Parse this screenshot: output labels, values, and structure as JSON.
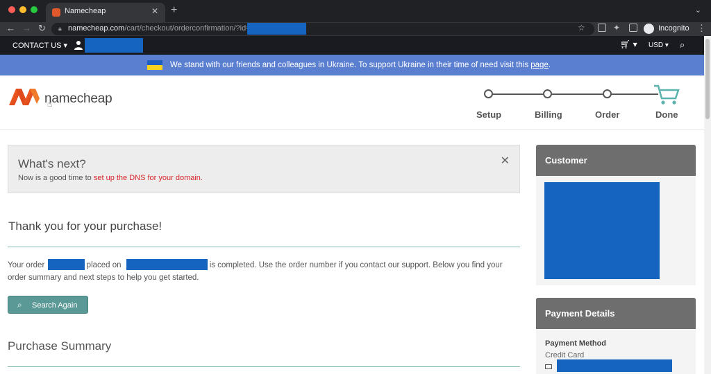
{
  "browser": {
    "tab_title": "Namecheap",
    "url_host": "namecheap.com",
    "url_path": "/cart/checkout/orderconfirmation/?id=",
    "profile_label": "Incognito"
  },
  "topbar": {
    "contact_label": "CONTACT US",
    "currency_label": "USD"
  },
  "banner": {
    "text": "We stand with our friends and colleagues in Ukraine. To support Ukraine in their time of need visit this ",
    "link": "page",
    "end": "."
  },
  "logo": {
    "text": "namecheap"
  },
  "steps": [
    "Setup",
    "Billing",
    "Order",
    "Done"
  ],
  "notice": {
    "title": "What's next?",
    "text_prefix": "Now is a good time to ",
    "link_text": "set up the DNS for your domain."
  },
  "confirmation": {
    "title": "Thank you for your purchase!",
    "order_prefix": "Your order",
    "placed_on": ", placed on",
    "completed_text": "is completed. Use the order number if you contact our support. Below you find your order summary and next steps to help you get started.",
    "search_again": "Search Again"
  },
  "summary": {
    "title": "Purchase Summary"
  },
  "customer": {
    "title": "Customer"
  },
  "payment": {
    "title": "Payment Details",
    "method_label": "Payment Method",
    "method_value": "Credit Card"
  },
  "colors": {
    "redaction": "#1565c0",
    "banner": "#5b7fd0",
    "brand_orange": "#e0592a",
    "teal_button": "#5a9996"
  }
}
